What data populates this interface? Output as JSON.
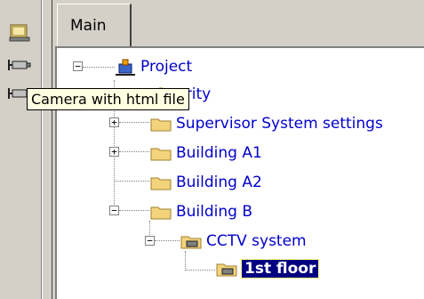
{
  "tabs": [
    {
      "label": "Main"
    }
  ],
  "tree": {
    "root": {
      "label": "Project",
      "expander": "−"
    },
    "items": [
      {
        "label": "Security",
        "visible_label": "urity",
        "expander": "+"
      },
      {
        "label": "Supervisor System settings",
        "expander": "+"
      },
      {
        "label": "Building A1",
        "expander": "+"
      },
      {
        "label": "Building A2",
        "expander": ""
      },
      {
        "label": "Building B",
        "expander": "−"
      },
      {
        "label": "CCTV system",
        "expander": "−"
      },
      {
        "label": "1st floor",
        "expander": "",
        "selected": true
      }
    ]
  },
  "tooltip": {
    "text": "Camera with html file"
  },
  "sidebar": {
    "buttons": [
      {
        "icon": "floorplan-icon"
      },
      {
        "icon": "camera-icon"
      },
      {
        "icon": "camera-icon"
      }
    ]
  },
  "colors": {
    "link": "#0000cc",
    "selection": "#000080",
    "folder": "#f3d37c",
    "tooltip_bg": "#ffffe1"
  }
}
